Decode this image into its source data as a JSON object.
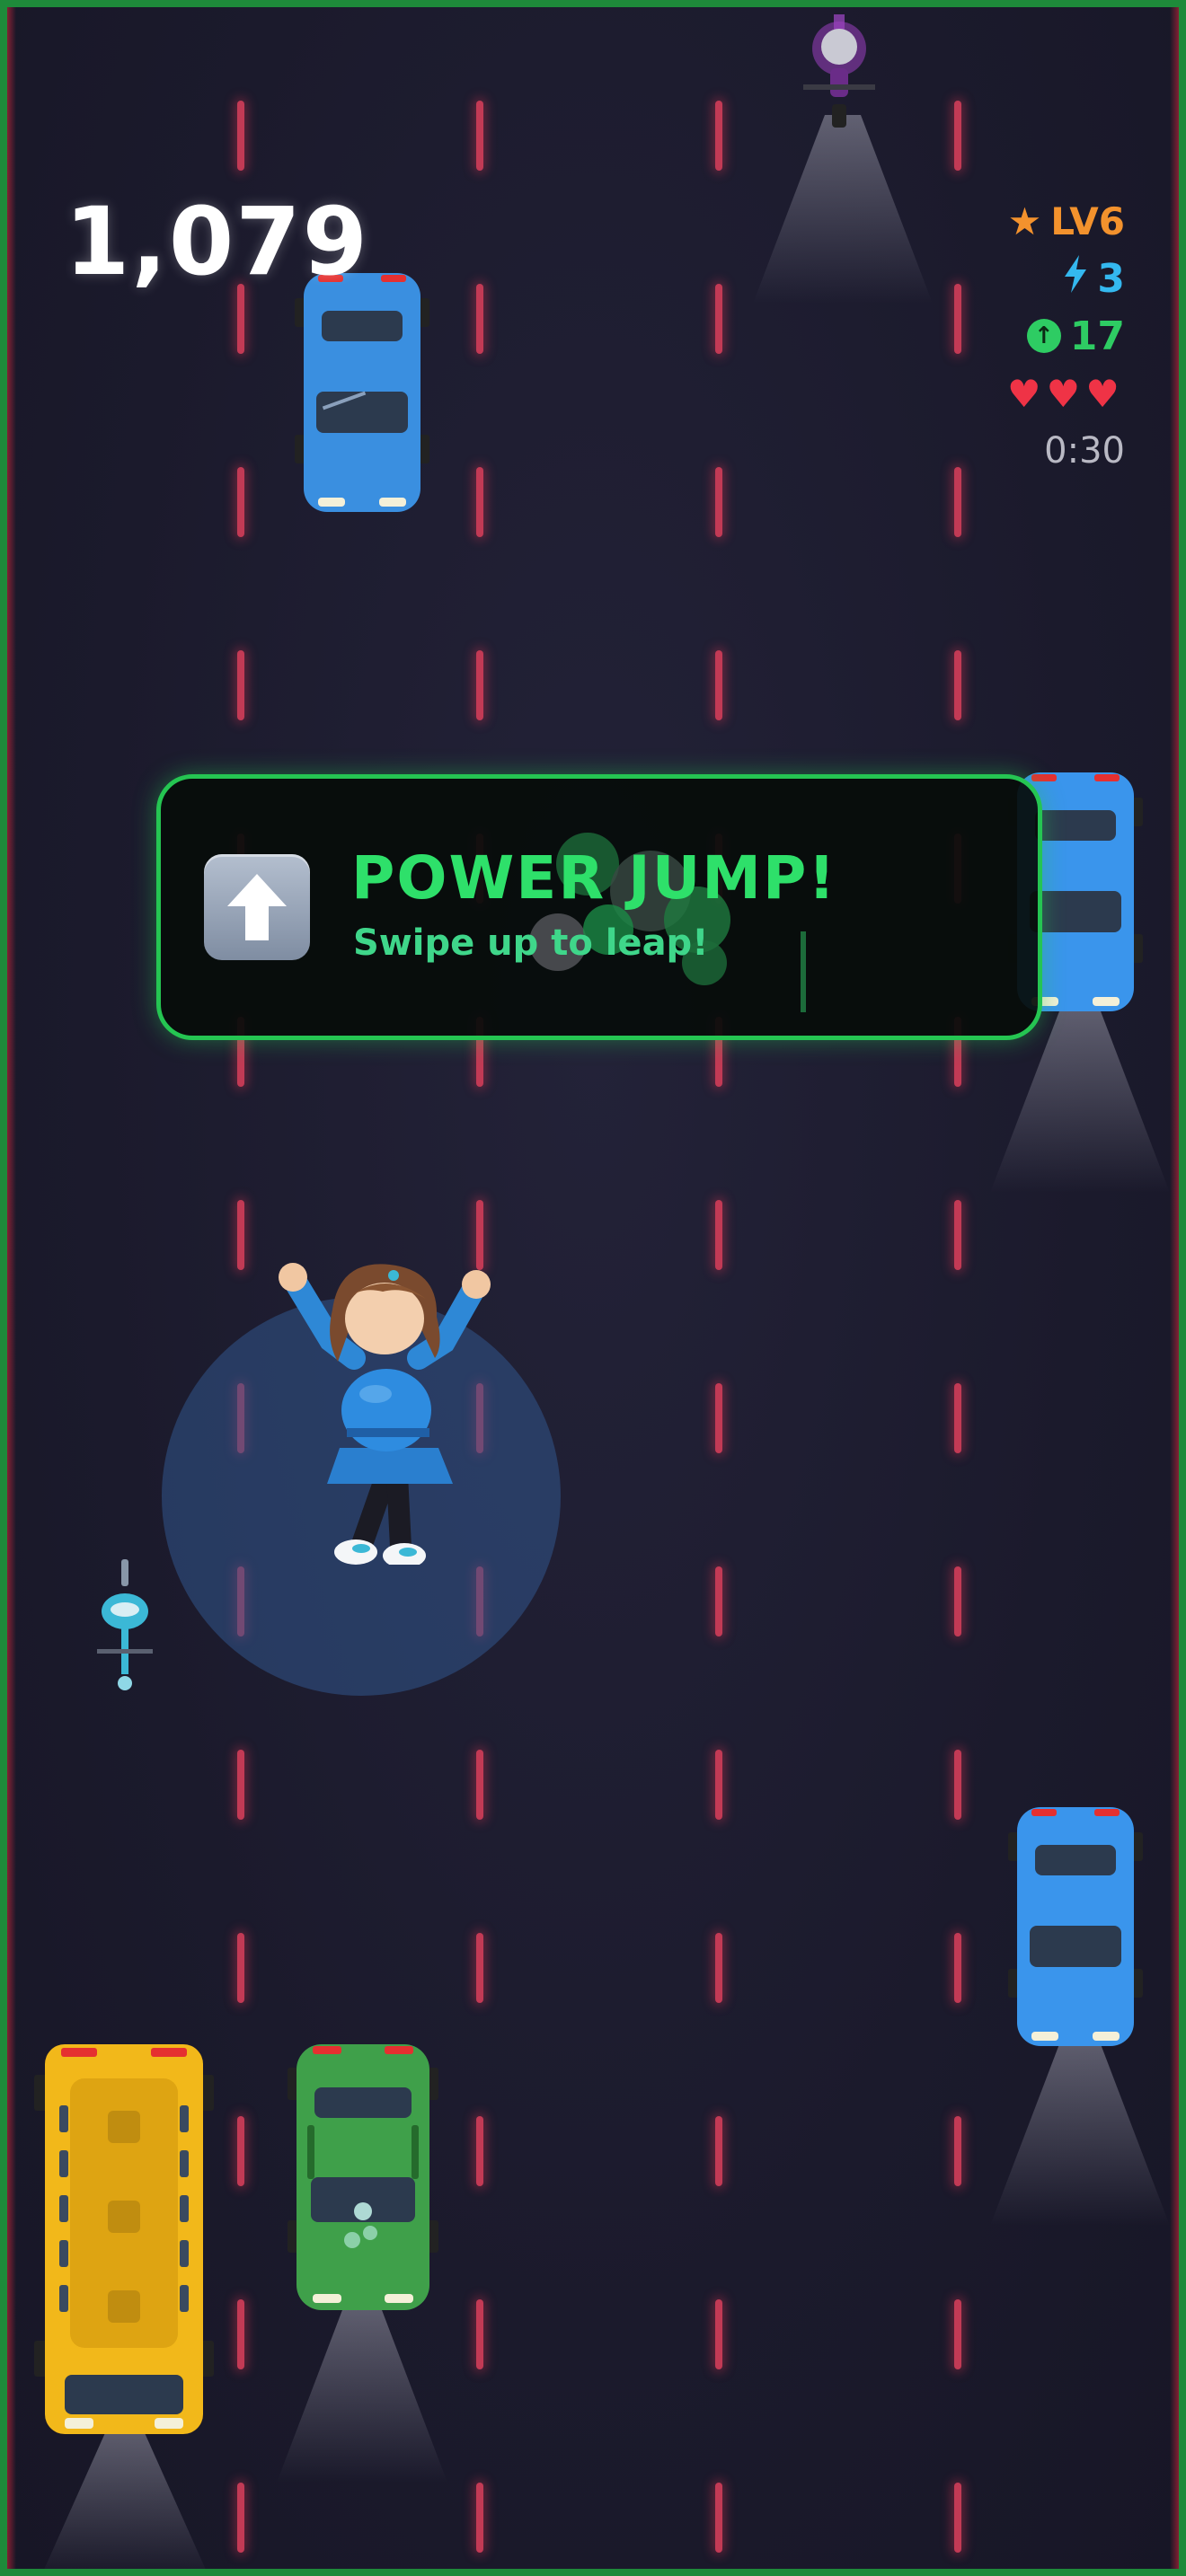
{
  "hud": {
    "score": "1,079",
    "level": "LV6",
    "energy": "3",
    "boost": "17",
    "hearts": "♥♥♥",
    "timer": "0:30"
  },
  "banner": {
    "title": "POWER JUMP!",
    "subtitle": "Swipe up to leap!"
  },
  "icons": {
    "level": "star-icon",
    "energy": "lightning-icon",
    "boost": "up-arrow-circle-icon",
    "lives": "heart-icon",
    "banner": "up-arrow-icon"
  },
  "colors": {
    "level": "#f3922d",
    "energy": "#34b8ef",
    "boost": "#2ecc63",
    "hearts": "#ef3346",
    "banner_border": "#25c552",
    "lane_markers": "#c23a55"
  }
}
